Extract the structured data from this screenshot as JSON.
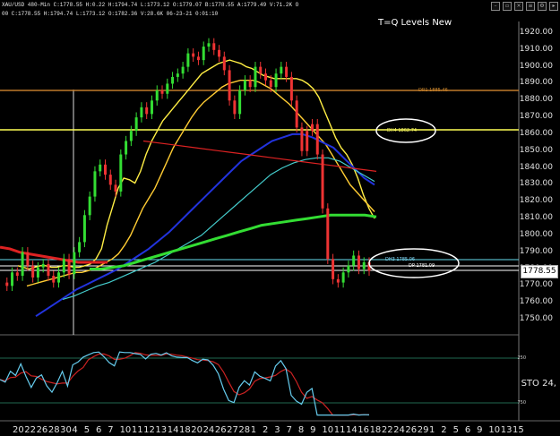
{
  "window": {
    "symbol_line": "XAU/USD  480-Min  C:1778.55  H:0.22  H:1794.74  L:1773.12  O:1779.07  B:1778.55  A:1779.49  V:71.2K  O",
    "ohlc_line": "00  C:1778.55  H:1794.74  L:1773.12  O:1782.36  V:28.6K  06-23-21  0:01:10",
    "toolbar_icons": [
      "minimize-icon",
      "restore-icon",
      "close-icon",
      "menu-icon",
      "settings-icon",
      "expand-icon"
    ]
  },
  "chart": {
    "title": "T=Q Levels New",
    "current_price": "1778.55",
    "y_ticks": [
      "1920.00",
      "1910.00",
      "1900.00",
      "1890.00",
      "1880.00",
      "1870.00",
      "1860.00",
      "1850.00",
      "1840.00",
      "1830.00",
      "1820.00",
      "1810.00",
      "1800.00",
      "1790.00",
      "1780.00",
      "1770.00",
      "1760.00",
      "1750.00"
    ],
    "x_ticks": [
      "20",
      "22",
      "26",
      "28",
      "30",
      "4",
      "5",
      "6",
      "7",
      "10",
      "11",
      "12",
      "13",
      "14",
      "18",
      "20",
      "24",
      "26",
      "27",
      "28",
      "1",
      "2",
      "3",
      "7",
      "8",
      "9",
      "10",
      "11",
      "14",
      "16",
      "18",
      "22",
      "24",
      "26",
      "29",
      "1",
      "2",
      "5",
      "6",
      "9",
      "10",
      "13",
      "15"
    ],
    "levels": [
      {
        "label": "DR1  1885.46",
        "color": "#d08a2c"
      },
      {
        "label": "DH4  1862.74",
        "color": "#ffff66"
      },
      {
        "label": "DH3  1785.06",
        "color": "#88ddff"
      },
      {
        "label": "DP  1781.09",
        "color": "#ffffff"
      }
    ]
  },
  "oscillator": {
    "label": "STO  24,",
    "level_labels": [
      "250",
      "750"
    ]
  },
  "chart_data": {
    "type": "line",
    "xlabel": "",
    "ylabel": "",
    "ylim": [
      1742,
      1925
    ],
    "series": [
      {
        "values": [
          1772,
          1770,
          1778,
          1776,
          1790,
          1782,
          1775,
          1781,
          1783,
          1776,
          1772,
          1778,
          1786,
          1777,
          1790,
          1796,
          1812,
          1823,
          1838,
          1842,
          1836,
          1830,
          1826,
          1848,
          1856,
          1862,
          1870,
          1876,
          1872,
          1880,
          1886,
          1884,
          1890,
          1894,
          1896,
          1900,
          1908,
          1906,
          1904,
          1912,
          1914,
          1910,
          1906,
          1898,
          1880,
          1872,
          1886,
          1892,
          1888,
          1900,
          1896,
          1892,
          1888,
          1896,
          1900,
          1894,
          1880,
          1864,
          1850,
          1862,
          1866,
          1848,
          1816,
          1786,
          1774,
          1772,
          1778,
          1782,
          1788,
          1780,
          1784,
          1779
        ]
      },
      {
        "values": [
          1782,
          1781,
          1780,
          1781,
          1782,
          1782,
          1781,
          1781,
          1782,
          1782,
          1781,
          1781,
          1782,
          1783,
          1786,
          1792,
          1806,
          1817,
          1828,
          1834,
          1833,
          1831,
          1838,
          1848,
          1856,
          1862,
          1868,
          1872,
          1876,
          1880,
          1884,
          1888,
          1892,
          1896,
          1898,
          1900,
          1902,
          1903,
          1904,
          1903,
          1902,
          1900,
          1899,
          1897,
          1895,
          1894,
          1893,
          1893,
          1893,
          1893,
          1893,
          1892,
          1890,
          1887,
          1882,
          1874,
          1866,
          1858,
          1852,
          1848,
          1842,
          1834,
          1824,
          1816,
          1810
        ]
      },
      {
        "values": [
          1770,
          1771,
          1772,
          1773,
          1774,
          1775,
          1776,
          1777,
          1778,
          1778,
          1779,
          1780,
          1782,
          1784,
          1786,
          1789,
          1794,
          1800,
          1808,
          1816,
          1822,
          1828,
          1836,
          1844,
          1852,
          1858,
          1864,
          1870,
          1875,
          1879,
          1882,
          1885,
          1888,
          1890,
          1891,
          1892,
          1892,
          1892,
          1891,
          1889,
          1887,
          1884,
          1881,
          1878,
          1874,
          1870,
          1866,
          1862,
          1858,
          1854,
          1848,
          1842,
          1836,
          1830,
          1826,
          1822,
          1818,
          1814
        ]
      },
      {
        "values": [
          1752,
          1756,
          1760,
          1764,
          1768,
          1771,
          1774,
          1777,
          1780,
          1784,
          1788,
          1792,
          1797,
          1802,
          1808,
          1814,
          1820,
          1826,
          1832,
          1838,
          1844,
          1848,
          1852,
          1856,
          1858,
          1860,
          1860,
          1858,
          1855,
          1852,
          1846,
          1840,
          1834,
          1830
        ]
      },
      {
        "values": [
          1762,
          1764,
          1767,
          1770,
          1772,
          1775,
          1778,
          1781,
          1784,
          1788,
          1792,
          1796,
          1800,
          1806,
          1812,
          1818,
          1824,
          1830,
          1836,
          1840,
          1843,
          1845,
          1846,
          1846,
          1844,
          1840,
          1836,
          1832
        ]
      },
      {
        "values": [
          1780,
          1780,
          1781,
          1782,
          1784,
          1786,
          1788,
          1790,
          1792,
          1794,
          1796,
          1798,
          1800,
          1802,
          1804,
          1806,
          1807,
          1808,
          1809,
          1810,
          1811,
          1812,
          1812,
          1812,
          1812,
          1811
        ]
      },
      {
        "values": [
          1793,
          1792,
          1790,
          1789,
          1788,
          1787,
          1786,
          1785,
          1784,
          1784,
          1784,
          1784
        ]
      },
      {
        "values": [
          1856,
          1854,
          1852,
          1850,
          1848,
          1846,
          1844,
          1842,
          1840,
          1838
        ]
      }
    ]
  }
}
